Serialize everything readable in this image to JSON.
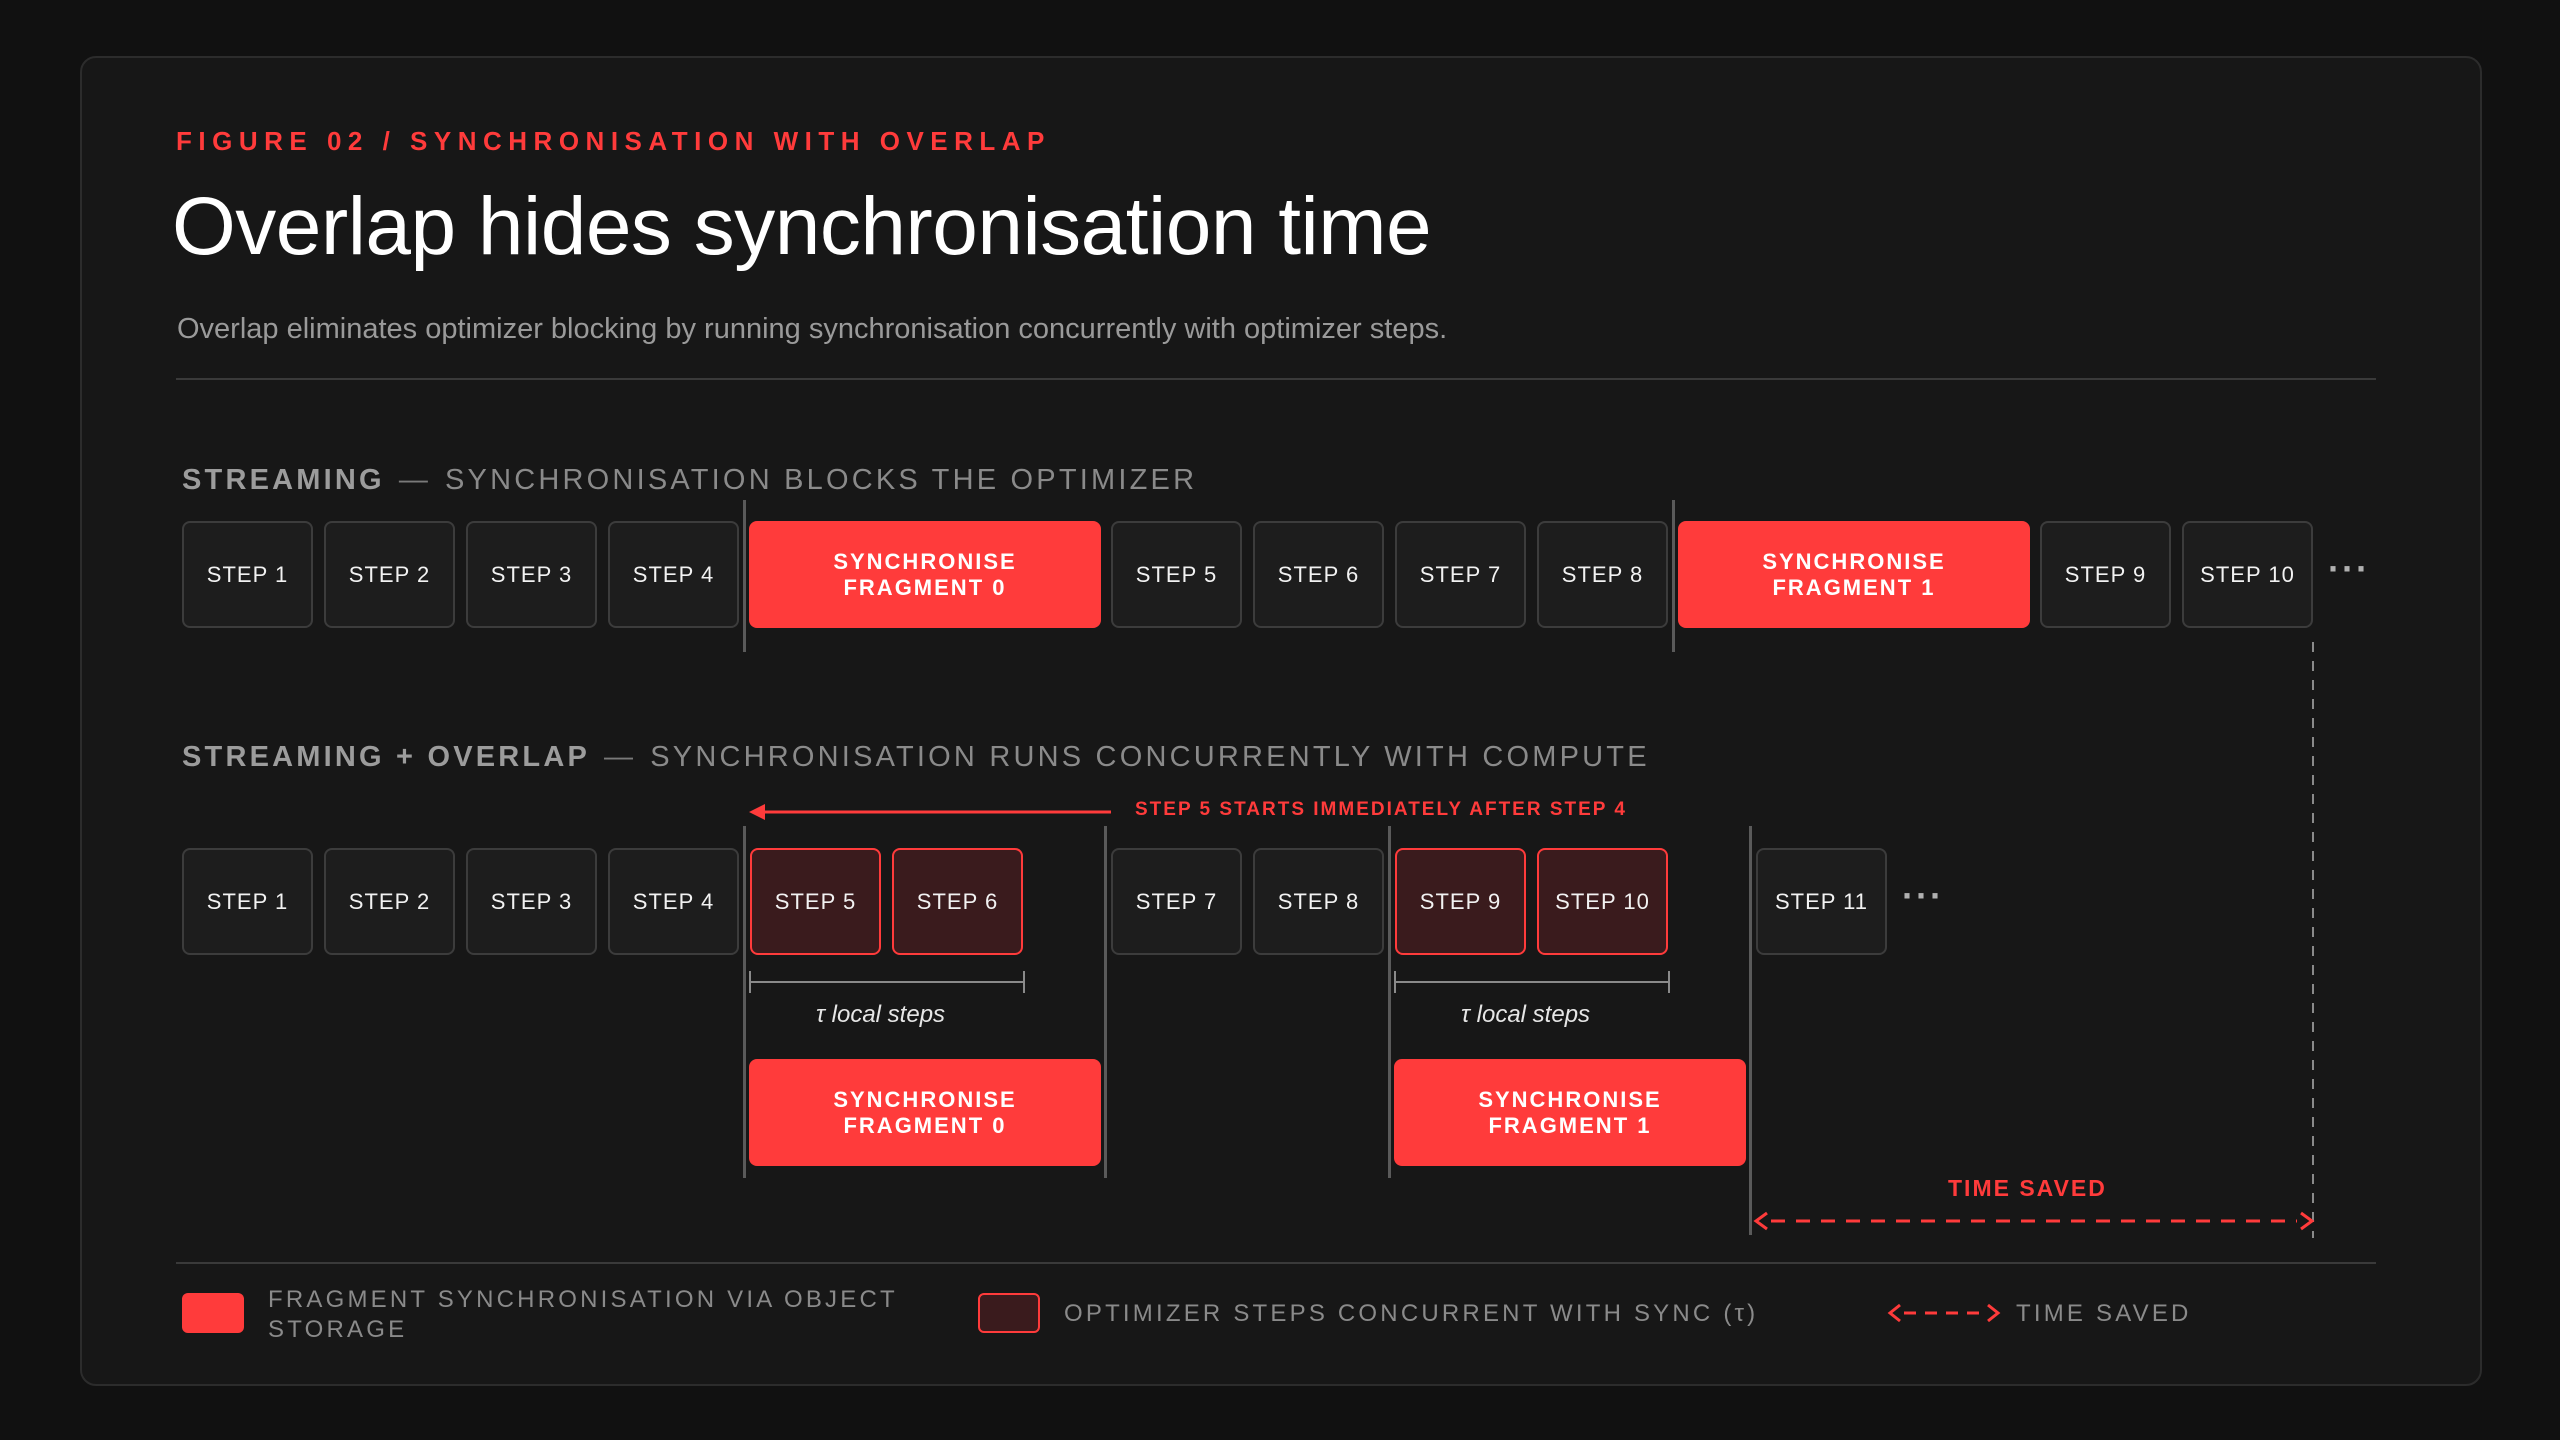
{
  "header": {
    "kicker": "FIGURE 02 / SYNCHRONISATION WITH OVERLAP",
    "title": "Overlap hides synchronisation time",
    "subtitle": "Overlap eliminates optimizer blocking by running synchronisation concurrently with optimizer steps."
  },
  "streaming": {
    "label_bold": "STREAMING",
    "dash": "—",
    "label_rest": "SYNCHRONISATION BLOCKS THE OPTIMIZER",
    "steps_a": [
      "STEP 1",
      "STEP 2",
      "STEP 3",
      "STEP 4"
    ],
    "sync0": [
      "SYNCHRONISE",
      "FRAGMENT 0"
    ],
    "steps_b": [
      "STEP 5",
      "STEP 6",
      "STEP 7",
      "STEP 8"
    ],
    "sync1": [
      "SYNCHRONISE",
      "FRAGMENT 1"
    ],
    "steps_c": [
      "STEP 9",
      "STEP 10"
    ],
    "ellipsis": "···"
  },
  "overlap": {
    "label_bold": "STREAMING + OVERLAP",
    "dash": "—",
    "label_rest": "SYNCHRONISATION RUNS CONCURRENTLY WITH COMPUTE",
    "annotation": "STEP 5 STARTS IMMEDIATELY AFTER STEP 4",
    "steps_a": [
      "STEP 1",
      "STEP 2",
      "STEP 3",
      "STEP 4"
    ],
    "overlap_a": [
      "STEP 5",
      "STEP 6"
    ],
    "steps_b": [
      "STEP 7",
      "STEP 8"
    ],
    "overlap_b": [
      "STEP 9",
      "STEP 10"
    ],
    "step_last": "STEP 11",
    "ellipsis": "···",
    "tau_label": "τ local steps",
    "sync0": [
      "SYNCHRONISE",
      "FRAGMENT 0"
    ],
    "sync1": [
      "SYNCHRONISE",
      "FRAGMENT 1"
    ],
    "time_saved": "TIME SAVED"
  },
  "legend": {
    "item1": "FRAGMENT SYNCHRONISATION VIA OBJECT STORAGE",
    "item2": "OPTIMIZER STEPS CONCURRENT WITH SYNC (τ)",
    "item3": "TIME SAVED"
  },
  "colors": {
    "accent": "#ff3b3b",
    "overlap_fill": "#3a1b1d",
    "background": "#171717"
  }
}
